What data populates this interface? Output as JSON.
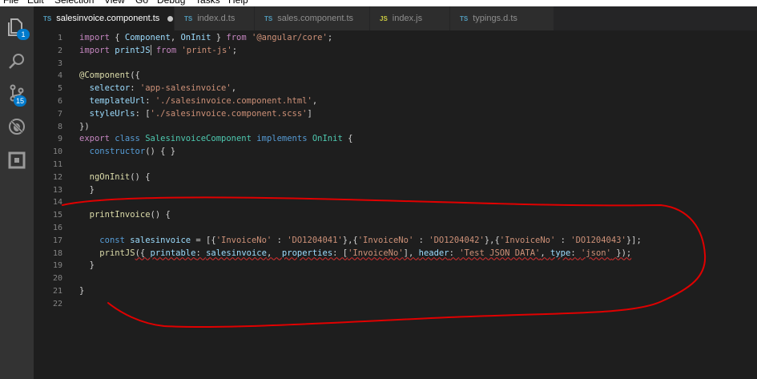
{
  "menu": [
    "File",
    "Edit",
    "Selection",
    "View",
    "Go",
    "Debug",
    "Tasks",
    "Help"
  ],
  "activity": {
    "explorer_badge": "1",
    "scm_badge": "15"
  },
  "tabs": [
    {
      "icon": "TS",
      "label": "salesinvoice.component.ts",
      "dirty": true
    },
    {
      "icon": "TS",
      "label": "index.d.ts"
    },
    {
      "icon": "TS",
      "label": "sales.component.ts"
    },
    {
      "icon": "JS",
      "label": "index.js"
    },
    {
      "icon": "TS",
      "label": "typings.d.ts"
    }
  ],
  "line_numbers": [
    "1",
    "2",
    "3",
    "4",
    "5",
    "6",
    "7",
    "8",
    "9",
    "10",
    "11",
    "12",
    "13",
    "14",
    "15",
    "16",
    "17",
    "18",
    "19",
    "20",
    "21",
    "22"
  ],
  "code": {
    "l1": [
      "import",
      " { ",
      "Component",
      ", ",
      "OnInit",
      " } ",
      "from",
      " ",
      "'@angular/core'",
      ";"
    ],
    "l2": [
      "import",
      " ",
      "printJS",
      " ",
      "from",
      " ",
      "'print-js'",
      ";"
    ],
    "l4": [
      "@Component",
      "({"
    ],
    "l5": [
      "  ",
      "selector",
      ": ",
      "'app-salesinvoice'",
      ","
    ],
    "l6": [
      "  ",
      "templateUrl",
      ": ",
      "'./salesinvoice.component.html'",
      ","
    ],
    "l7": [
      "  ",
      "styleUrls",
      ": [",
      "'./salesinvoice.component.scss'",
      "]"
    ],
    "l8": [
      "})"
    ],
    "l9": [
      "export",
      " ",
      "class",
      " ",
      "SalesinvoiceComponent",
      " ",
      "implements",
      " ",
      "OnInit",
      " {"
    ],
    "l10": [
      "  ",
      "constructor",
      "() { }"
    ],
    "l12": [
      "  ",
      "ngOnInit",
      "() {"
    ],
    "l13": [
      "  }"
    ],
    "l15": [
      "  ",
      "printInvoice",
      "() {"
    ],
    "l17": [
      "    ",
      "const",
      " ",
      "salesinvoice",
      " = [{",
      "'InvoiceNo'",
      " : ",
      "'DO1204041'",
      "},{",
      "'InvoiceNo'",
      " : ",
      "'DO1204042'",
      "},{",
      "'InvoiceNo'",
      " : ",
      "'DO1204043'",
      "}];"
    ],
    "l18": [
      "    ",
      "printJS",
      "({ ",
      "printable",
      ": ",
      "salesinvoice",
      ",  ",
      "properties",
      ": [",
      "'InvoiceNo'",
      "], ",
      "header",
      ": ",
      "'Test JSON DATA'",
      ", ",
      "type",
      ": ",
      "'json'",
      " });"
    ],
    "l19": [
      "  }"
    ],
    "l21": [
      "}"
    ]
  }
}
